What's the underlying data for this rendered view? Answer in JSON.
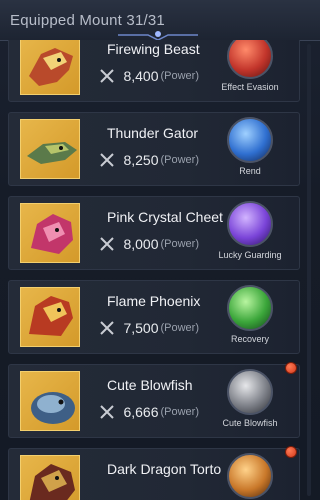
{
  "header": {
    "title": "Equipped Mount 31/31"
  },
  "colors": {
    "portrait_gold": "#e7b64a",
    "notify_red": "#e04a26"
  },
  "mounts": [
    {
      "name": "Firewing Beast",
      "power": "8,400",
      "power_label": "(Power)",
      "skill": "Effect Evasion",
      "skill_color": "#c2352b",
      "portrait": "firewing-beast",
      "notify": false
    },
    {
      "name": "Thunder Gator",
      "power": "8,250",
      "power_label": "(Power)",
      "skill": "Rend",
      "skill_color": "#2f6fd0",
      "portrait": "thunder-gator",
      "notify": false
    },
    {
      "name": "Pink Crystal Cheet",
      "power": "8,000",
      "power_label": "(Power)",
      "skill": "Lucky Guarding",
      "skill_color": "#7a44d8",
      "portrait": "pink-crystal-cheetah",
      "notify": false
    },
    {
      "name": "Flame Phoenix",
      "power": "7,500",
      "power_label": "(Power)",
      "skill": "Recovery",
      "skill_color": "#3ba63a",
      "portrait": "flame-phoenix",
      "notify": false
    },
    {
      "name": "Cute Blowfish",
      "power": "6,666",
      "power_label": "(Power)",
      "skill": "Cute Blowfish",
      "skill_color": "#7d8088",
      "portrait": "cute-blowfish",
      "notify": true
    },
    {
      "name": "Dark Dragon Torto",
      "power": "",
      "power_label": "",
      "skill": "",
      "skill_color": "#c9782a",
      "portrait": "dark-dragon-tortoise",
      "notify": true
    }
  ]
}
